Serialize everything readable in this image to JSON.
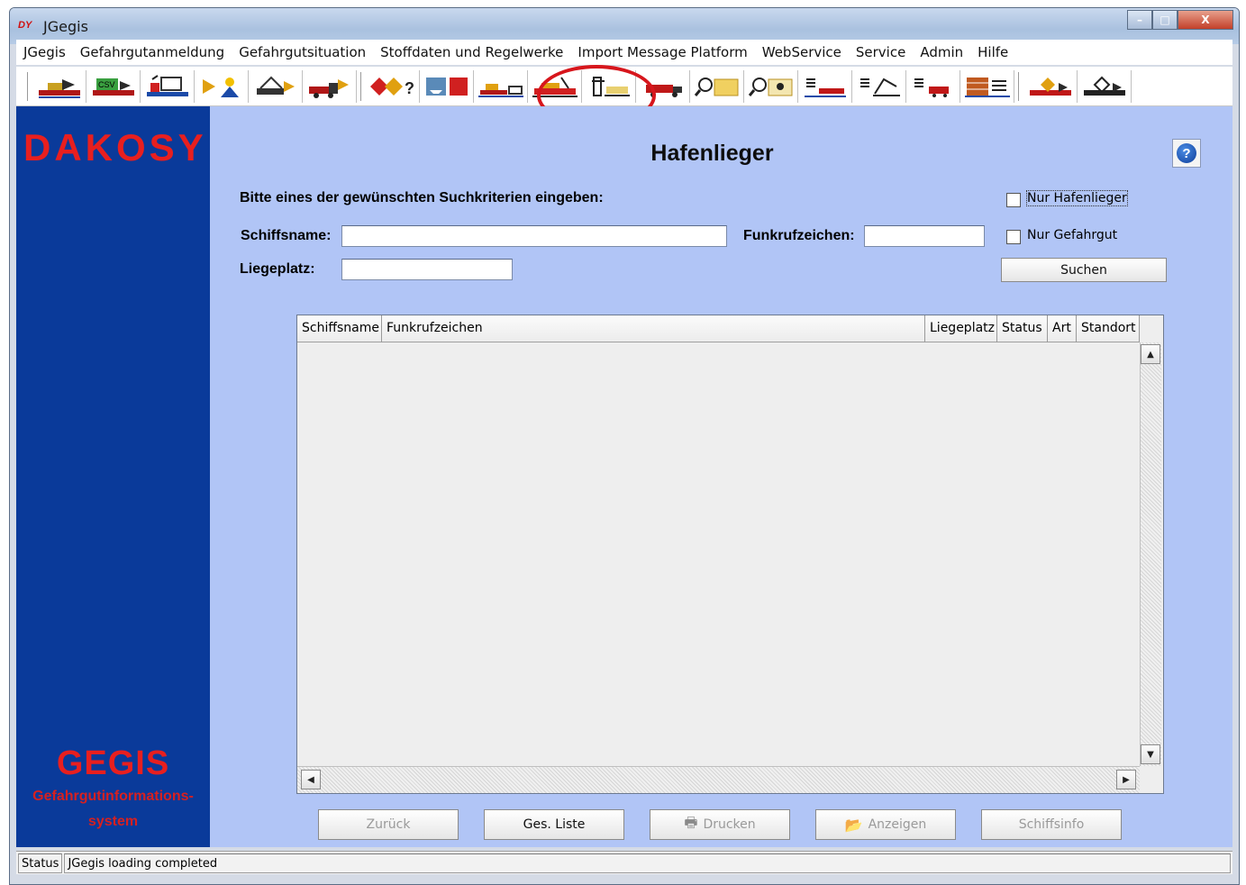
{
  "window": {
    "logo": "DY",
    "title": "JGegis",
    "minimize": "–",
    "maximize": "□",
    "close": "X"
  },
  "menu": [
    "JGegis",
    "Gefahrgutanmeldung",
    "Gefahrgutsituation",
    "Stoffdaten und Regelwerke",
    "Import Message Platform",
    "WebService",
    "Service",
    "Admin",
    "Hilfe"
  ],
  "toolbar": {
    "icons": [
      "ship-arrow-icon",
      "csv-ship-icon",
      "crane-ship-icon",
      "arrow-person-icon",
      "truck-crane-icon",
      "truck-arrow-icon",
      "hazard-diamond-icon",
      "ship-fire-icon",
      "harbor-ship-icon",
      "ship-berth-icon",
      "crane-container-icon",
      "truck-red-icon",
      "magnifier-container-icon",
      "magnifier-skull-icon",
      "list-ship-icon",
      "list-crane-icon",
      "list-truck-icon",
      "container-list-icon",
      "ship-hazard-icon",
      "ship-hazard-2-icon"
    ],
    "highlight_color": "#d7161c"
  },
  "sidebar": {
    "brand": "DAKOSY",
    "product": "GEGIS",
    "subtitle_line1": "Gefahrgutinformations-",
    "subtitle_line2": "system"
  },
  "main": {
    "title": "Hafenlieger",
    "instruction": "Bitte eines der gewünschten Suchkriterien eingeben:",
    "schiffsname_label": "Schiffsname:",
    "schiffsname_value": "",
    "funkrufzeichen_label": "Funkrufzeichen:",
    "funkrufzeichen_value": "",
    "liegeplatz_label": "Liegeplatz:",
    "liegeplatz_value": "",
    "nur_hafenlieger_label": "Nur Hafenlieger",
    "nur_hafenlieger_checked": false,
    "nur_gefahrgut_label": "Nur Gefahrgut",
    "nur_gefahrgut_checked": false,
    "search_button": "Suchen",
    "help": "?"
  },
  "table": {
    "columns": [
      "Schiffsname",
      "Funkrufzeichen",
      "Liegeplatz",
      "Status",
      "Art",
      "Standort"
    ],
    "rows": []
  },
  "buttons": {
    "zurueck": "Zurück",
    "ges_liste": "Ges. Liste",
    "drucken": "Drucken",
    "anzeigen": "Anzeigen",
    "schiffsinfo": "Schiffsinfo"
  },
  "status": {
    "label": "Status",
    "message": "JGegis loading completed"
  },
  "colors": {
    "sidebar": "#0a3a9a",
    "brand_red": "#e81f1f",
    "content_bg": "#b1c5f6"
  }
}
